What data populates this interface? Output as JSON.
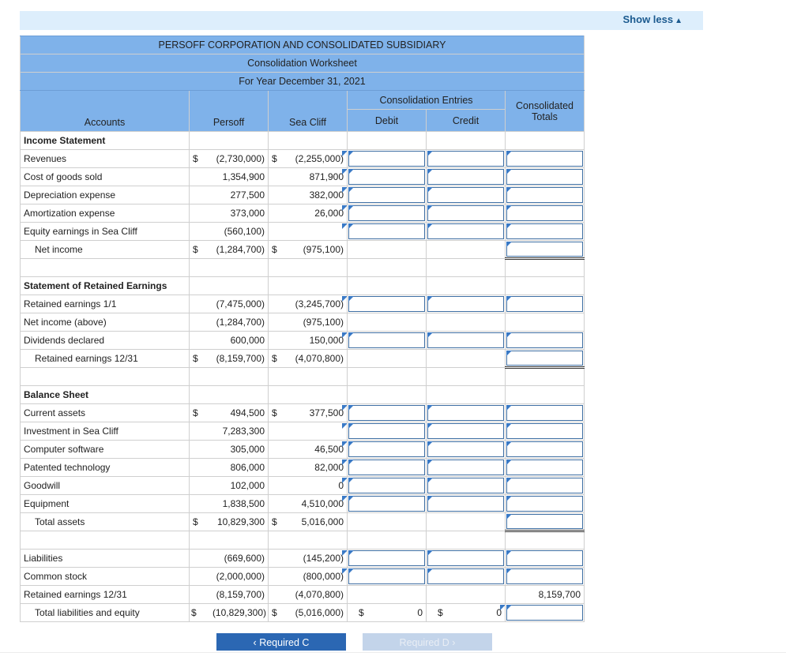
{
  "toggle": {
    "label": "Show less",
    "icon": "triangle-up-icon"
  },
  "title": {
    "company": "PERSOFF CORPORATION AND CONSOLIDATED SUBSIDIARY",
    "worksheet": "Consolidation Worksheet",
    "period": "For Year December 31, 2021"
  },
  "headers": {
    "accounts": "Accounts",
    "persoff": "Persoff",
    "seacliff": "Sea Cliff",
    "entries": "Consolidation Entries",
    "debit": "Debit",
    "credit": "Credit",
    "consolidated_line1": "Consolidated",
    "consolidated_line2": "Totals"
  },
  "income": {
    "section": "Income Statement",
    "rows": [
      {
        "label": "Revenues",
        "p_cur": "$",
        "p": "(2,730,000)",
        "s_cur": "$",
        "s": "(2,255,000)"
      },
      {
        "label": "Cost of goods sold",
        "p": "1,354,900",
        "s": "871,900"
      },
      {
        "label": "Depreciation expense",
        "p": "277,500",
        "s": "382,000"
      },
      {
        "label": "Amortization expense",
        "p": "373,000",
        "s": "26,000"
      },
      {
        "label": "Equity earnings in Sea Cliff",
        "p": "(560,100)",
        "s": ""
      }
    ],
    "total": {
      "label": "Net income",
      "p_cur": "$",
      "p": "(1,284,700)",
      "s_cur": "$",
      "s": "(975,100)"
    }
  },
  "retained": {
    "section": "Statement of Retained Earnings",
    "rows": [
      {
        "label": "Retained earnings 1/1",
        "p": "(7,475,000)",
        "s": "(3,245,700)"
      },
      {
        "label": "Net income (above)",
        "p": "(1,284,700)",
        "s": "(975,100)"
      },
      {
        "label": "Dividends declared",
        "p": "600,000",
        "s": "150,000"
      }
    ],
    "total": {
      "label": "Retained earnings 12/31",
      "p_cur": "$",
      "p": "(8,159,700)",
      "s_cur": "$",
      "s": "(4,070,800)"
    }
  },
  "balance": {
    "section": "Balance Sheet",
    "rows": [
      {
        "label": "Current assets",
        "p_cur": "$",
        "p": "494,500",
        "s_cur": "$",
        "s": "377,500"
      },
      {
        "label": "Investment in Sea Cliff",
        "p": "7,283,300",
        "s": ""
      },
      {
        "label": "Computer software",
        "p": "305,000",
        "s": "46,500"
      },
      {
        "label": "Patented technology",
        "p": "806,000",
        "s": "82,000"
      },
      {
        "label": "Goodwill",
        "p": "102,000",
        "s": "0"
      },
      {
        "label": "Equipment",
        "p": "1,838,500",
        "s": "4,510,000"
      }
    ],
    "total": {
      "label": "Total assets",
      "p_cur": "$",
      "p": "10,829,300",
      "s_cur": "$",
      "s": "5,016,000"
    }
  },
  "liabilities": {
    "rows": [
      {
        "label": "Liabilities",
        "p": "(669,600)",
        "s": "(145,200)"
      },
      {
        "label": "Common stock",
        "p": "(2,000,000)",
        "s": "(800,000)"
      },
      {
        "label": "Retained earnings 12/31",
        "p": "(8,159,700)",
        "s": "(4,070,800)",
        "consolidated": "8,159,700"
      }
    ],
    "total": {
      "label": "Total liabilities and equity",
      "p_cur": "$",
      "p": "(10,829,300)",
      "s_cur": "$",
      "s": "(5,016,000)",
      "d_cur": "$",
      "d": "0",
      "c_cur": "$",
      "c": "0"
    }
  },
  "nav": {
    "prev_label": "Required C",
    "next_label": "Required D"
  }
}
